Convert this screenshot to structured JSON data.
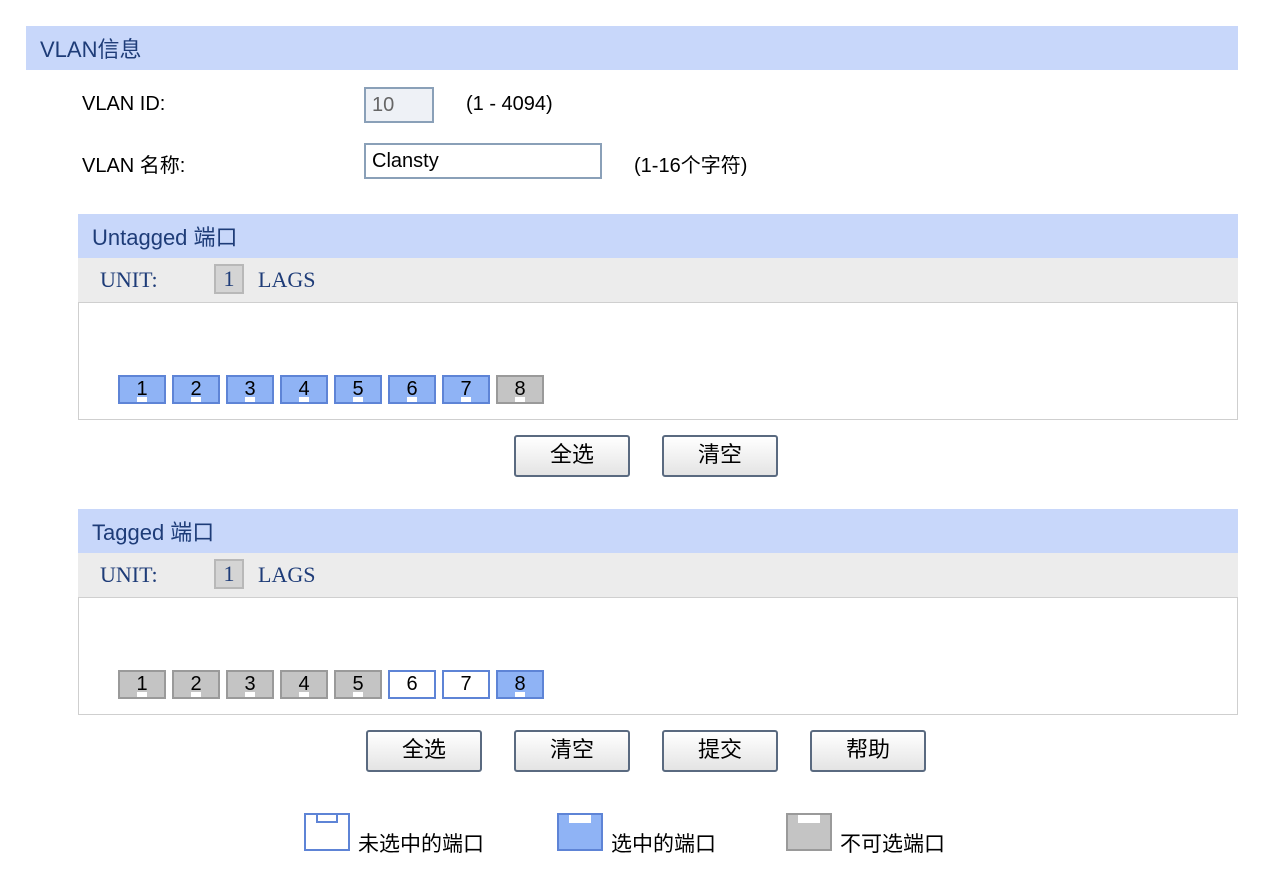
{
  "vlan_info": {
    "header": "VLAN信息",
    "vlan_id_label": "VLAN ID:",
    "vlan_id_value": "10",
    "vlan_id_hint": "(1 - 4094)",
    "vlan_name_label": "VLAN 名称:",
    "vlan_name_value": "Clansty",
    "vlan_name_hint": "(1-16个字符)"
  },
  "untagged": {
    "header": "Untagged 端口",
    "unit_label": "UNIT:",
    "unit_number": "1",
    "lags_label": "LAGS",
    "ports": [
      {
        "label": "1",
        "state": "selected"
      },
      {
        "label": "2",
        "state": "selected"
      },
      {
        "label": "3",
        "state": "selected"
      },
      {
        "label": "4",
        "state": "selected"
      },
      {
        "label": "5",
        "state": "selected"
      },
      {
        "label": "6",
        "state": "selected"
      },
      {
        "label": "7",
        "state": "selected"
      },
      {
        "label": "8",
        "state": "disabled"
      }
    ],
    "buttons": {
      "select_all": "全选",
      "clear": "清空"
    }
  },
  "tagged": {
    "header": "Tagged 端口",
    "unit_label": "UNIT:",
    "unit_number": "1",
    "lags_label": "LAGS",
    "ports": [
      {
        "label": "1",
        "state": "disabled"
      },
      {
        "label": "2",
        "state": "disabled"
      },
      {
        "label": "3",
        "state": "disabled"
      },
      {
        "label": "4",
        "state": "disabled"
      },
      {
        "label": "5",
        "state": "disabled"
      },
      {
        "label": "6",
        "state": "unselected"
      },
      {
        "label": "7",
        "state": "unselected"
      },
      {
        "label": "8",
        "state": "selected"
      }
    ],
    "buttons": {
      "select_all": "全选",
      "clear": "清空",
      "submit": "提交",
      "help": "帮助"
    }
  },
  "legend": {
    "unselected": "未选中的端口",
    "selected": "选中的端口",
    "disabled": "不可选端口"
  },
  "colors": {
    "header_bg": "#c8d7fa",
    "selected_port": "#8fb3f5",
    "disabled_port": "#c4c4c4"
  }
}
